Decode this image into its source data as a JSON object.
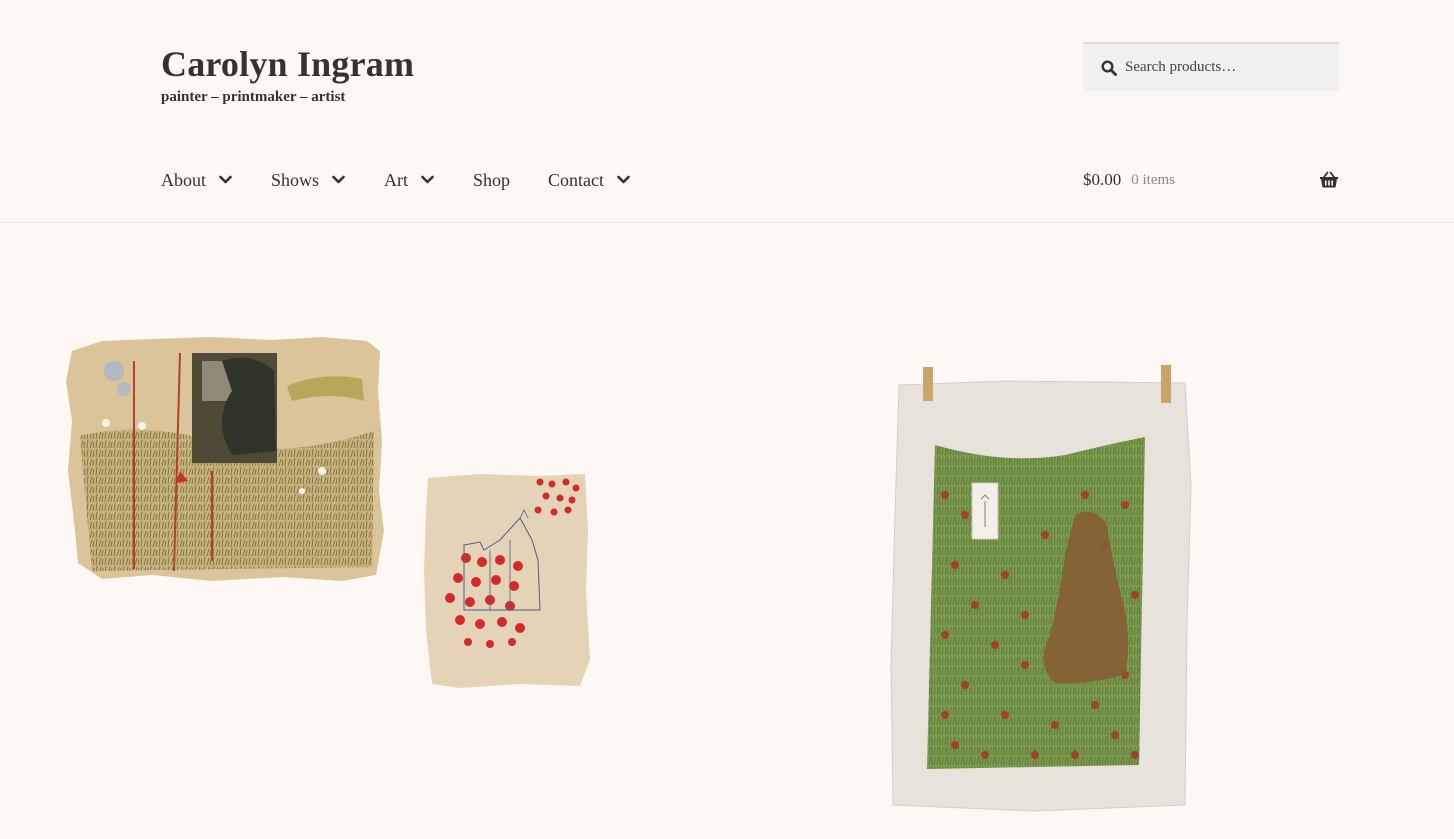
{
  "site": {
    "title": "Carolyn Ingram",
    "tagline": "painter – printmaker – artist"
  },
  "search": {
    "placeholder": "Search products…",
    "icon": "search-icon"
  },
  "nav": {
    "items": [
      {
        "label": "About",
        "has_submenu": true
      },
      {
        "label": "Shows",
        "has_submenu": true
      },
      {
        "label": "Art",
        "has_submenu": true
      },
      {
        "label": "Shop",
        "has_submenu": false
      },
      {
        "label": "Contact",
        "has_submenu": true
      }
    ]
  },
  "cart": {
    "amount": "$0.00",
    "count": "0 items",
    "icon": "basket-icon"
  },
  "colors": {
    "background": "#fdf8f3",
    "text": "#333333",
    "muted": "#8a8a8a",
    "search_bg": "#f0f0f0"
  },
  "artworks": [
    {
      "name": "artwork-garden-collage"
    },
    {
      "name": "artwork-house-poppies"
    },
    {
      "name": "artwork-poppy-field-print"
    }
  ]
}
